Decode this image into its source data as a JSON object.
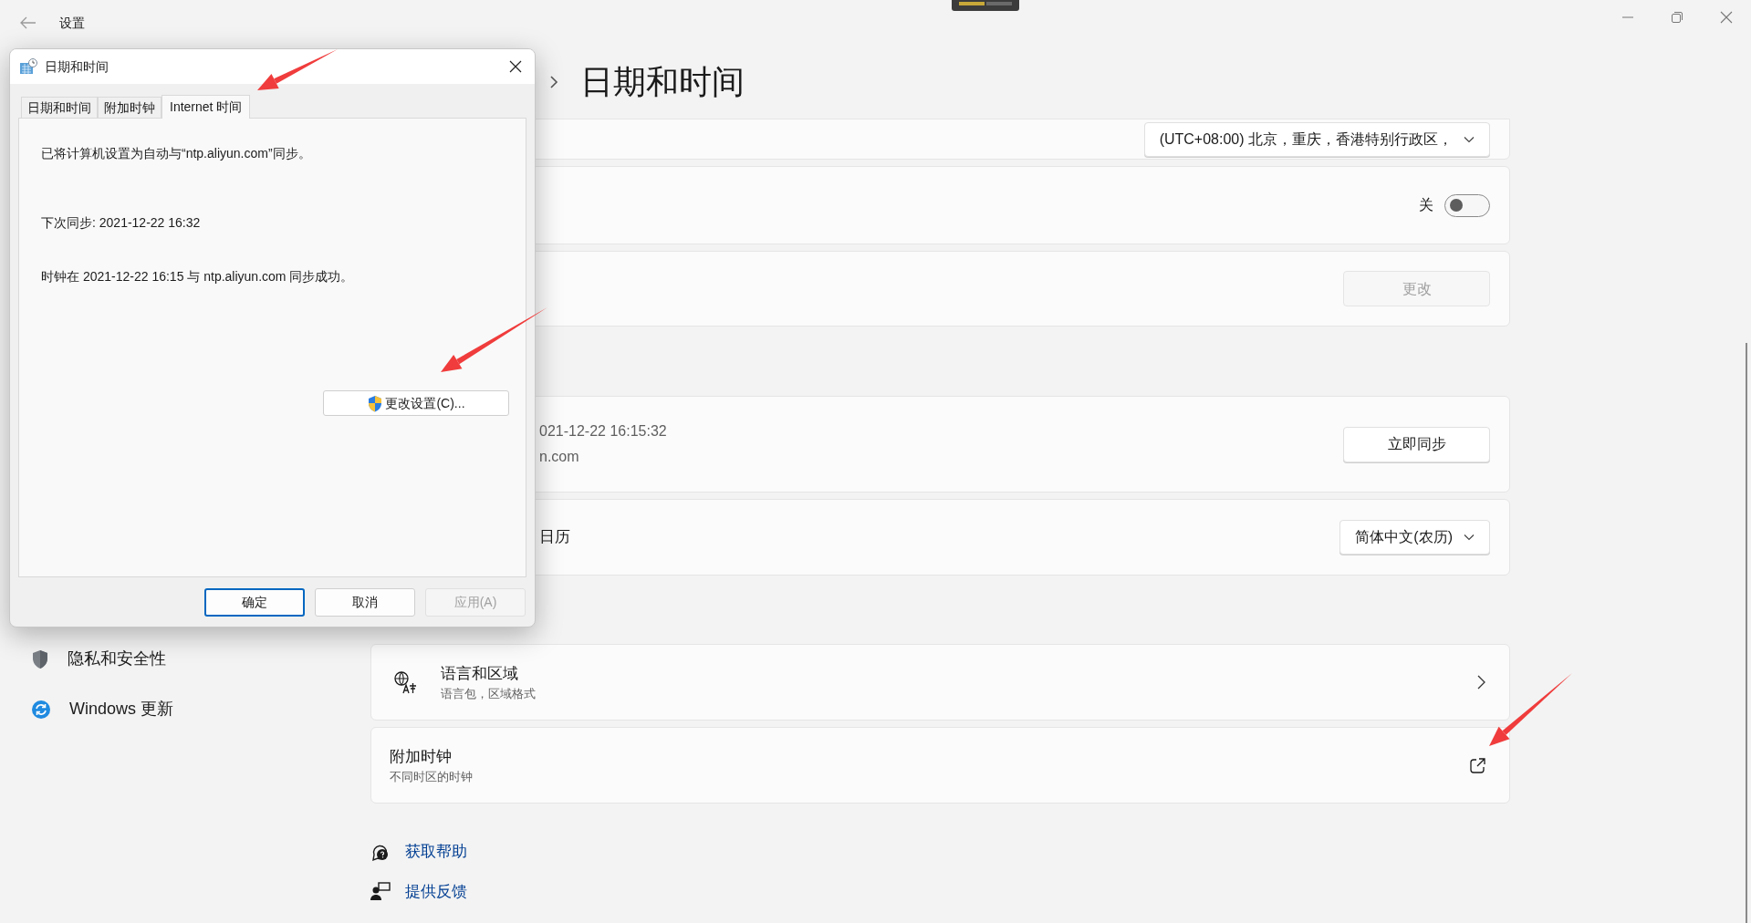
{
  "window": {
    "title": "设置"
  },
  "page": {
    "title": "日期和时间"
  },
  "sections": [
    {
      "cards": [
        {
          "kind": "dropdown",
          "control": "(UTC+08:00) 北京，重庆，香港特别行政区，"
        },
        {
          "kind": "toggle",
          "control": "关",
          "on": false
        },
        {
          "kind": "button",
          "control": "更改",
          "disabled": true
        }
      ]
    },
    {
      "cards": [
        {
          "kind": "button",
          "lines": [
            "021-12-22 16:15:32",
            "n.com"
          ],
          "control": "立即同步",
          "disabled": false
        },
        {
          "kind": "dropdown",
          "lines": [
            "日历"
          ],
          "control": "简体中文(农历)"
        }
      ]
    }
  ],
  "related_links": [
    {
      "title": "语言和区域",
      "subtitle": "语言包，区域格式",
      "kind": "chevron"
    },
    {
      "title": "附加时钟",
      "subtitle": "不同时区的时钟",
      "kind": "external"
    }
  ],
  "help_links": [
    {
      "label": "获取帮助",
      "kind": "help"
    },
    {
      "label": "提供反馈",
      "kind": "feedback"
    }
  ],
  "sidebar": {
    "items": [
      {
        "label": "隐私和安全性",
        "kind": "privacy"
      },
      {
        "label": "Windows 更新",
        "kind": "update"
      }
    ]
  },
  "dialog": {
    "title": "日期和时间",
    "tabs": [
      {
        "label": "日期和时间",
        "selected": false
      },
      {
        "label": "附加时钟",
        "selected": false
      },
      {
        "label": "Internet 时间",
        "selected": true
      }
    ],
    "lines": [
      "已将计算机设置为自动与“ntp.aliyun.com”同步。",
      "下次同步: 2021-12-22 16:32",
      "时钟在 2021-12-22 16:15 与 ntp.aliyun.com 同步成功。"
    ],
    "change_button": "更改设置(C)...",
    "buttons": [
      {
        "label": "确定",
        "default": true,
        "disabled": false
      },
      {
        "label": "取消",
        "default": false,
        "disabled": false
      },
      {
        "label": "应用(A)",
        "default": false,
        "disabled": true
      }
    ]
  }
}
